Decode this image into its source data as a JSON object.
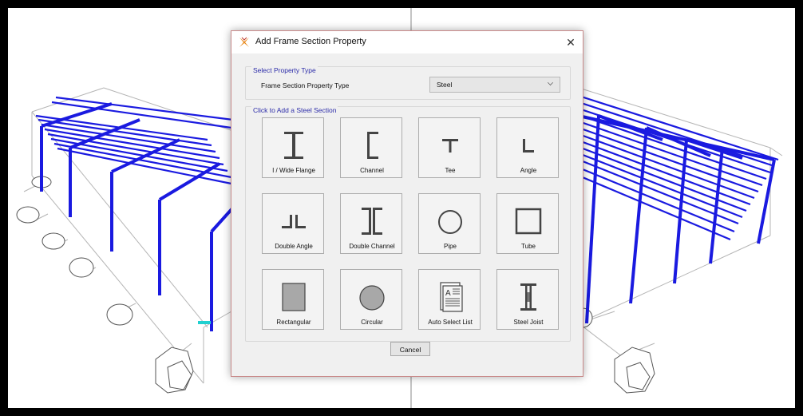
{
  "dialog": {
    "title": "Add Frame Section Property",
    "close_glyph": "✕",
    "app_icon": "etabs-logo-icon",
    "property_type_group": {
      "legend": "Select Property Type",
      "field_label": "Frame Section Property Type",
      "selected_value": "Steel"
    },
    "sections_group": {
      "legend": "Click to Add a Steel Section",
      "tiles": [
        {
          "label": "I / Wide Flange",
          "icon": "i-wide-flange-icon"
        },
        {
          "label": "Channel",
          "icon": "channel-icon"
        },
        {
          "label": "Tee",
          "icon": "tee-icon"
        },
        {
          "label": "Angle",
          "icon": "angle-icon"
        },
        {
          "label": "Double Angle",
          "icon": "double-angle-icon"
        },
        {
          "label": "Double Channel",
          "icon": "double-channel-icon"
        },
        {
          "label": "Pipe",
          "icon": "pipe-icon"
        },
        {
          "label": "Tube",
          "icon": "tube-icon"
        },
        {
          "label": "Rectangular",
          "icon": "rectangular-icon"
        },
        {
          "label": "Circular",
          "icon": "circular-icon"
        },
        {
          "label": "Auto Select List",
          "icon": "auto-select-list-icon"
        },
        {
          "label": "Steel Joist",
          "icon": "steel-joist-icon"
        }
      ]
    },
    "cancel_label": "Cancel"
  },
  "background": {
    "description_colors": {
      "members": "#1a1ae0",
      "grid_lines": "#b0b0b0"
    }
  }
}
